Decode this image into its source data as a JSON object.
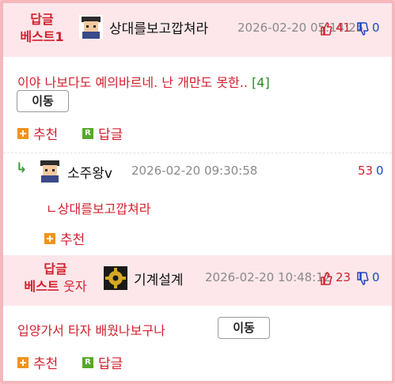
{
  "comments": [
    {
      "best_line1": "답글",
      "best_line2": "베스트1",
      "nick": "상대를보고깝쳐라",
      "date": "2026-02-20 05:14:25",
      "up": "41",
      "down": "0",
      "text": "이야 나보다도 예의바르네. 난 개만도 못한..",
      "reply_count": "[4]",
      "move_label": "이동",
      "recommend_label": "추천",
      "reply_label": "답글"
    },
    {
      "nick": "소주왕v",
      "date": "2026-02-20 09:30:58",
      "up": "53",
      "down": "0",
      "reply_to": "ㄴ상대를보고깝쳐라",
      "recommend_label": "추천"
    },
    {
      "best_line1": "답글",
      "best_line2": "베스트",
      "best_suffix": "웃자",
      "nick": "기계설계",
      "date": "2026-02-20 10:48:12",
      "up": "23",
      "down": "0",
      "text": "입양가서 타자 배웠나보구나",
      "move_label": "이동",
      "recommend_label": "추천",
      "reply_label": "답글"
    }
  ],
  "colors": {
    "accent_red": "#d3202e",
    "header_bg": "#fde7ea",
    "border_pink": "#f6b7bd",
    "down_blue": "#1a46c8"
  },
  "icons": [
    "avatar-icon",
    "thumb-up-icon",
    "thumb-down-icon",
    "plus-icon",
    "reply-r-icon",
    "reply-arrow-icon",
    "gear-avatar-icon"
  ]
}
